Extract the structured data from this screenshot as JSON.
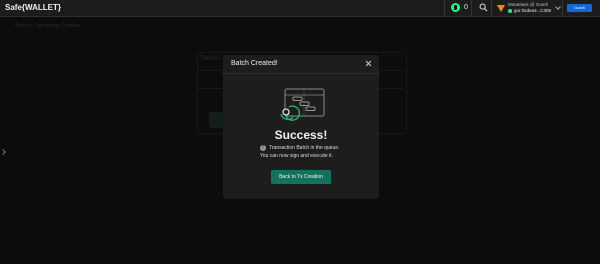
{
  "header": {
    "app_title": "Safe{WALLET}",
    "safe_count": "0",
    "wallet": {
      "name": "MetaMask @ Goerli",
      "address": "gor:0xdea3...C308"
    },
    "network_button_label": "Goerli"
  },
  "background": {
    "back_link": "‹ Back to Transaction Creation",
    "card_title": "Review a"
  },
  "modal": {
    "title": "Batch Created!",
    "heading": "Success!",
    "info_line1": "Transaction Batch in the queue.",
    "info_line2": "You can now sign and execute it.",
    "button_label": "Back to Tx Creation"
  },
  "colors": {
    "accent": "#12ff80",
    "primary_button": "#12725d",
    "network_button": "#1568d1"
  }
}
